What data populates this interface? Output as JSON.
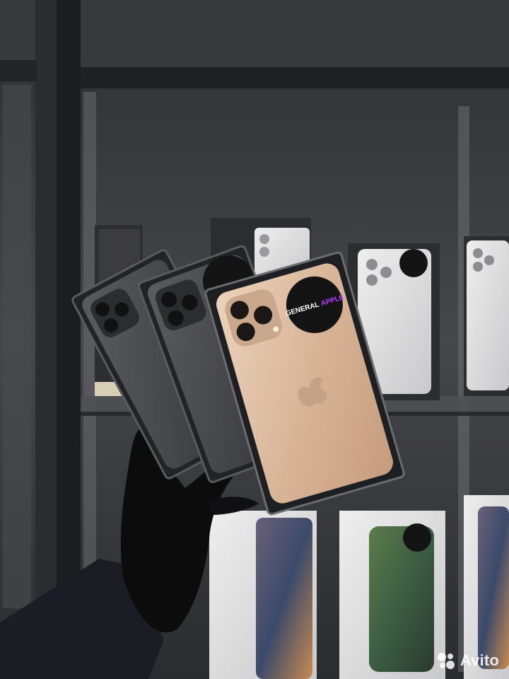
{
  "photo": {
    "watermark": "Avito",
    "sticker_word_1": "GENERAL",
    "sticker_word_2": "APPLE",
    "colors": {
      "wall": "#3a3b3e",
      "frame": "#1e1f22",
      "glass": "#55575b",
      "gold_phone": "#d9b99c",
      "gray_phone": "#4a4b4e",
      "sticker": "#141414",
      "sticker_accent": "#b33cff",
      "glove": "#0c0c0d",
      "sweater": "#1a1d24"
    }
  }
}
